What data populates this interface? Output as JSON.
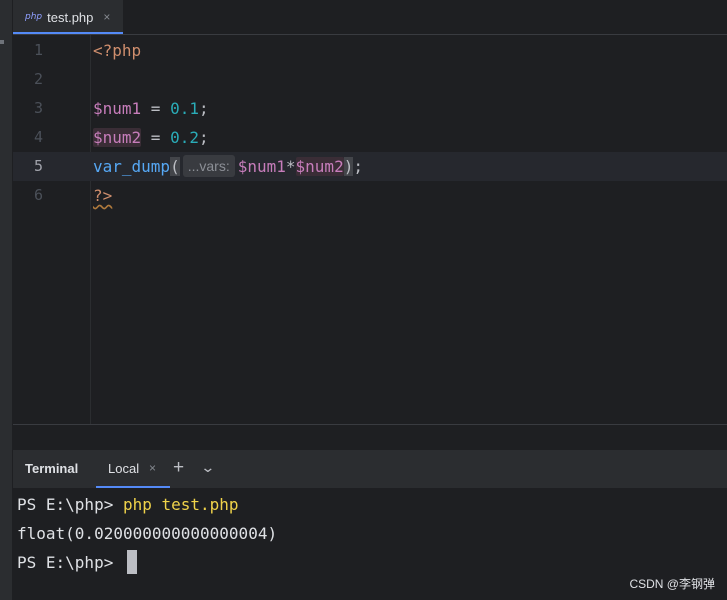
{
  "tab": {
    "icon_text": "php",
    "label": "test.php",
    "close": "×"
  },
  "editor": {
    "lines": [
      {
        "n": "1"
      },
      {
        "n": "2"
      },
      {
        "n": "3"
      },
      {
        "n": "4"
      },
      {
        "n": "5"
      },
      {
        "n": "6"
      }
    ],
    "tokens": {
      "open_tag": "<?php",
      "num1": "$num1",
      "eq": " = ",
      "val1": "0.1",
      "semi": ";",
      "num2": "$num2",
      "val2": "0.2",
      "fn": "var_dump",
      "lparen": "(",
      "hint": "...vars:",
      "arg1": "$num1",
      "mul": "*",
      "arg2": "$num2",
      "rparen": ")",
      "close_tag": "?>"
    }
  },
  "terminal": {
    "title": "Terminal",
    "tab_label": "Local",
    "tab_close": "×",
    "plus": "+",
    "chevron": "⌄",
    "lines": {
      "prompt1": "PS E:\\php> ",
      "cmd1": "php test.php",
      "output": "float(0.020000000000000004)",
      "prompt2": "PS E:\\php> "
    }
  },
  "watermark": "CSDN @李钢弹"
}
